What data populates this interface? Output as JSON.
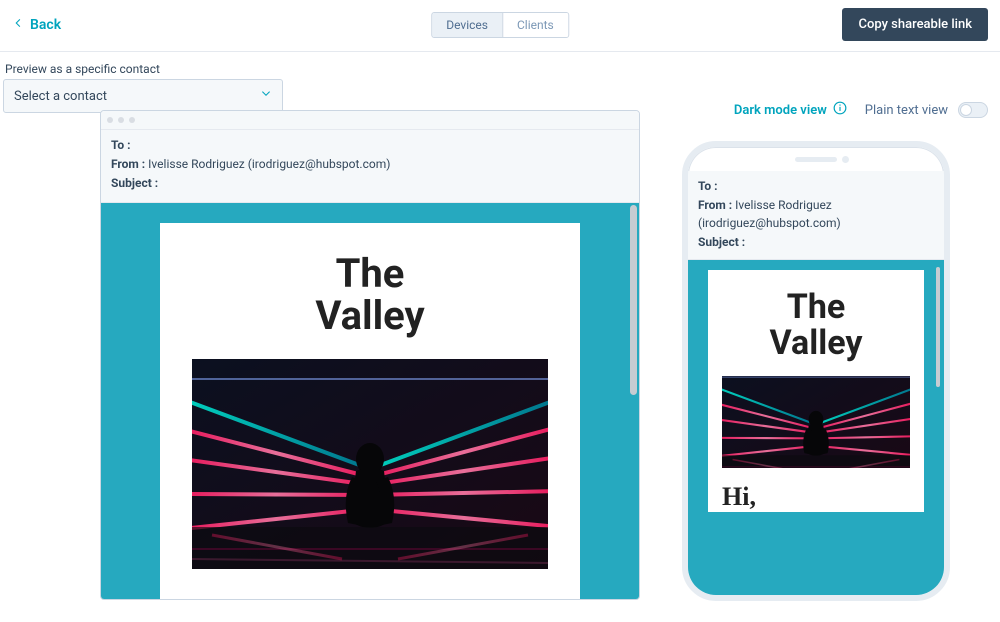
{
  "nav": {
    "back_label": "Back"
  },
  "segmented": {
    "devices": "Devices",
    "clients": "Clients",
    "active": "devices"
  },
  "actions": {
    "copy_link": "Copy shareable link"
  },
  "contact_selector": {
    "label": "Preview as a specific contact",
    "placeholder": "Select a contact"
  },
  "view_options": {
    "dark_mode": "Dark mode view",
    "plain_text": "Plain text view",
    "plain_text_on": false
  },
  "email": {
    "to_label": "To :",
    "to_value": "",
    "from_label": "From :",
    "from_name": "Ivelisse Rodriguez",
    "from_email": "(irodriguez@hubspot.com)",
    "subject_label": "Subject :",
    "subject_value": "",
    "content_title_line1": "The",
    "content_title_line2": "Valley",
    "greeting": "Hi,"
  },
  "colors": {
    "accent": "#00a4bd",
    "nav_btn": "#33475b",
    "mail_bg": "#26a9bf"
  }
}
